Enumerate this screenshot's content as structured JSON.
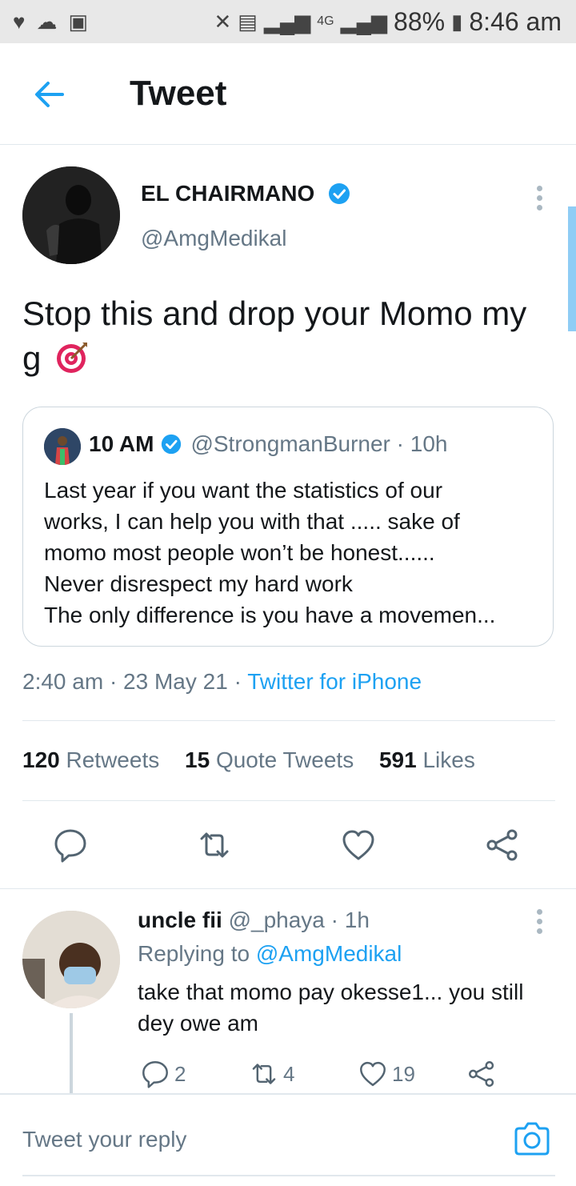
{
  "status_bar": {
    "network": "4G",
    "battery": "88%",
    "time": "8:46 am"
  },
  "header": {
    "title": "Tweet"
  },
  "tweet": {
    "author_name": "EL CHAIRMANO",
    "author_handle": "@AmgMedikal",
    "text": "Stop this and drop your Momo my g",
    "timestamp": "2:40 am · 23 May 21 · ",
    "source": "Twitter for iPhone",
    "stats": {
      "retweets_count": "120",
      "retweets_label": "Retweets",
      "quotes_count": "15",
      "quotes_label": "Quote Tweets",
      "likes_count": "591",
      "likes_label": "Likes"
    }
  },
  "quoted_tweet": {
    "name": "10 AM",
    "handle_time": "@StrongmanBurner · 10h",
    "lines": [
      "Last year if you want the statistics of our",
      "works, I can help you with that ..... sake of",
      "momo most people won’t be honest......",
      "Never disrespect my hard work",
      "The only difference is you have a movemen..."
    ]
  },
  "reply": {
    "name": "uncle fii",
    "handle_time": "@_phaya · 1h",
    "replying_prefix": "Replying to",
    "replying_to": "@AmgMedikal",
    "text": "take that momo pay okesse1... you still dey owe am",
    "reply_count": "2",
    "retweet_count": "4",
    "like_count": "19"
  },
  "compose": {
    "placeholder": "Tweet your reply"
  },
  "colors": {
    "accent": "#1da1f2",
    "secondary_text": "#657786",
    "icon": "#536471",
    "divider": "#e1e8ed"
  },
  "icons": {
    "back": "arrow-left-icon",
    "verified": "verified-badge-icon",
    "more": "more-vertical-icon",
    "target": "direct-hit-emoji",
    "reply": "speech-bubble-icon",
    "retweet": "retweet-icon",
    "like": "heart-icon",
    "share": "share-icon",
    "camera": "camera-icon"
  }
}
